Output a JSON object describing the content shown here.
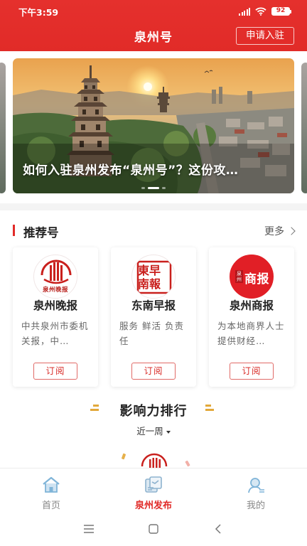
{
  "status_bar": {
    "time": "下午3:59",
    "battery": "92"
  },
  "header": {
    "title": "泉州号",
    "apply_label": "申请入驻"
  },
  "banner": {
    "caption": "如何入驻泉州发布“泉州号”？这份攻…",
    "slide_count": 3,
    "active_index": 1
  },
  "recommend": {
    "title": "推荐号",
    "more_label": "更多",
    "cards": [
      {
        "name": "泉州晚报",
        "desc": "中共泉州市委机关报，中…",
        "subscribe_label": "订阅",
        "logo_text": "泉州晚报"
      },
      {
        "name": "东南早报",
        "desc": "服务 鲜活 负责任",
        "subscribe_label": "订阅",
        "logo_text": "東早南報"
      },
      {
        "name": "泉州商报",
        "desc": "为本地商界人士提供财经…",
        "subscribe_label": "订阅",
        "logo_text": "商报",
        "logo_small": "泉州"
      }
    ]
  },
  "ranking": {
    "title": "影响力排行",
    "period": "近一周"
  },
  "tabbar": {
    "tabs": [
      {
        "label": "首页",
        "icon": "home-icon"
      },
      {
        "label": "泉州发布",
        "icon": "publish-icon",
        "active": true
      },
      {
        "label": "我的",
        "icon": "profile-icon"
      }
    ]
  },
  "colors": {
    "brand_red": "#e12b28",
    "accent_gold": "#e2a83a"
  }
}
